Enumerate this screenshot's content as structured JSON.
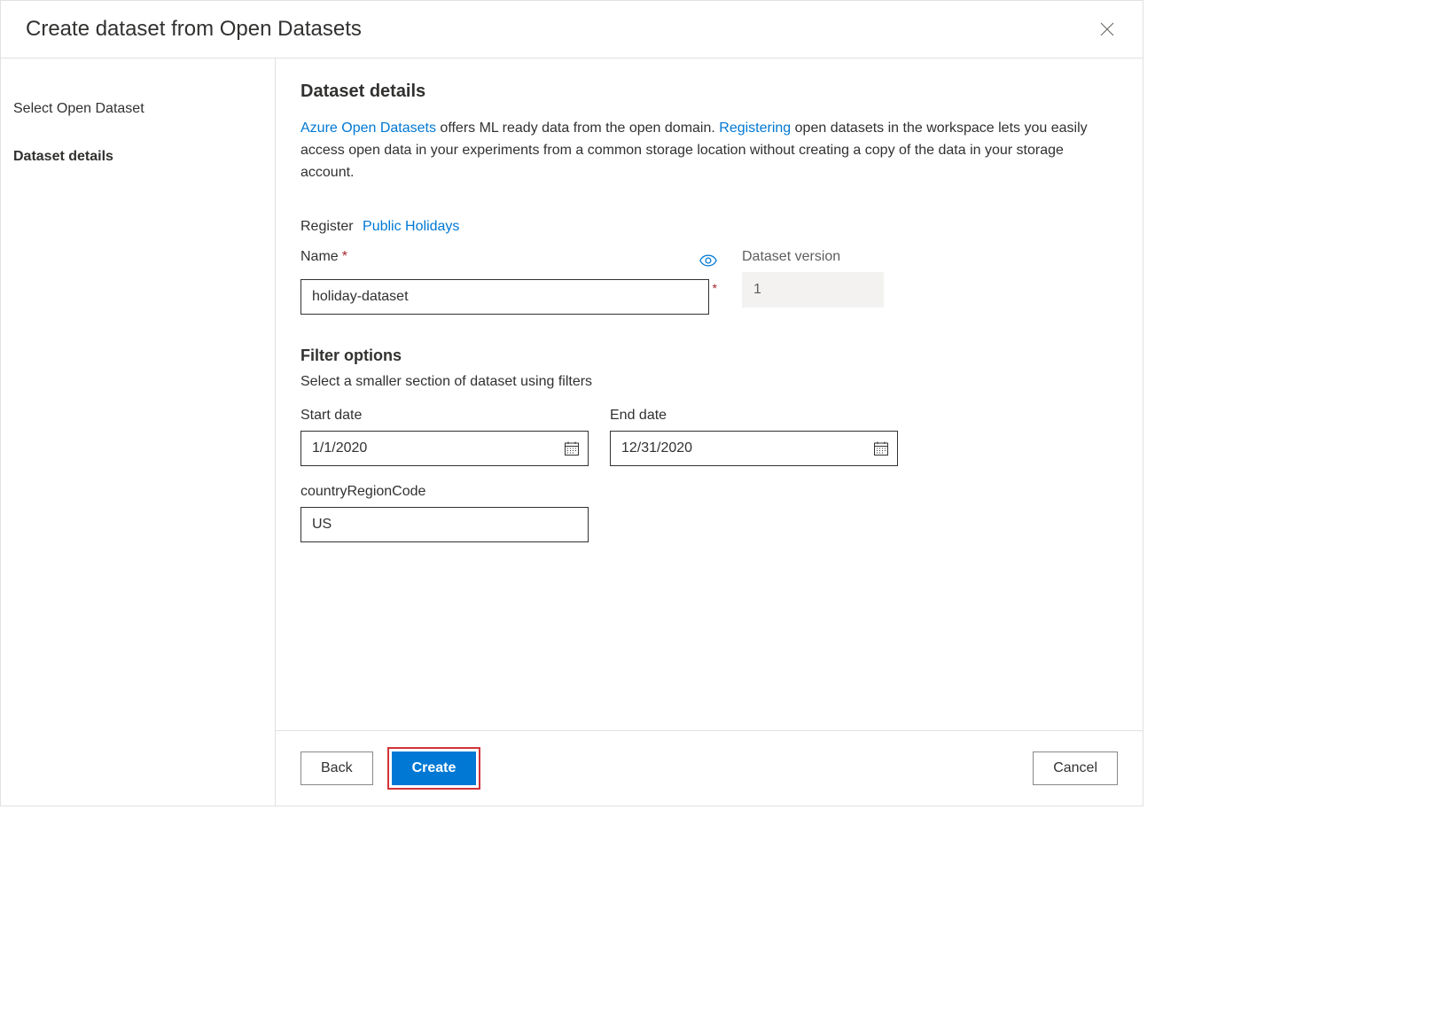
{
  "dialog": {
    "title": "Create dataset from Open Datasets"
  },
  "sidebar": {
    "items": [
      {
        "label": "Select Open Dataset"
      },
      {
        "label": "Dataset details"
      }
    ]
  },
  "main": {
    "heading": "Dataset details",
    "description": {
      "link1": "Azure Open Datasets",
      "text1": " offers ML ready data from the open domain. ",
      "link2": "Registering",
      "text2": " open datasets in the workspace lets you easily access open data in your experiments from a common storage location without creating a copy of the data in your storage account."
    },
    "register": {
      "label": "Register",
      "link": "Public Holidays"
    },
    "name": {
      "label": "Name",
      "value": "holiday-dataset"
    },
    "version": {
      "label": "Dataset version",
      "value": "1"
    },
    "filter": {
      "heading": "Filter options",
      "sub": "Select a smaller section of dataset using filters",
      "start": {
        "label": "Start date",
        "value": "1/1/2020"
      },
      "end": {
        "label": "End date",
        "value": "12/31/2020"
      },
      "country": {
        "label": "countryRegionCode",
        "value": "US"
      }
    }
  },
  "footer": {
    "back": "Back",
    "create": "Create",
    "cancel": "Cancel"
  }
}
